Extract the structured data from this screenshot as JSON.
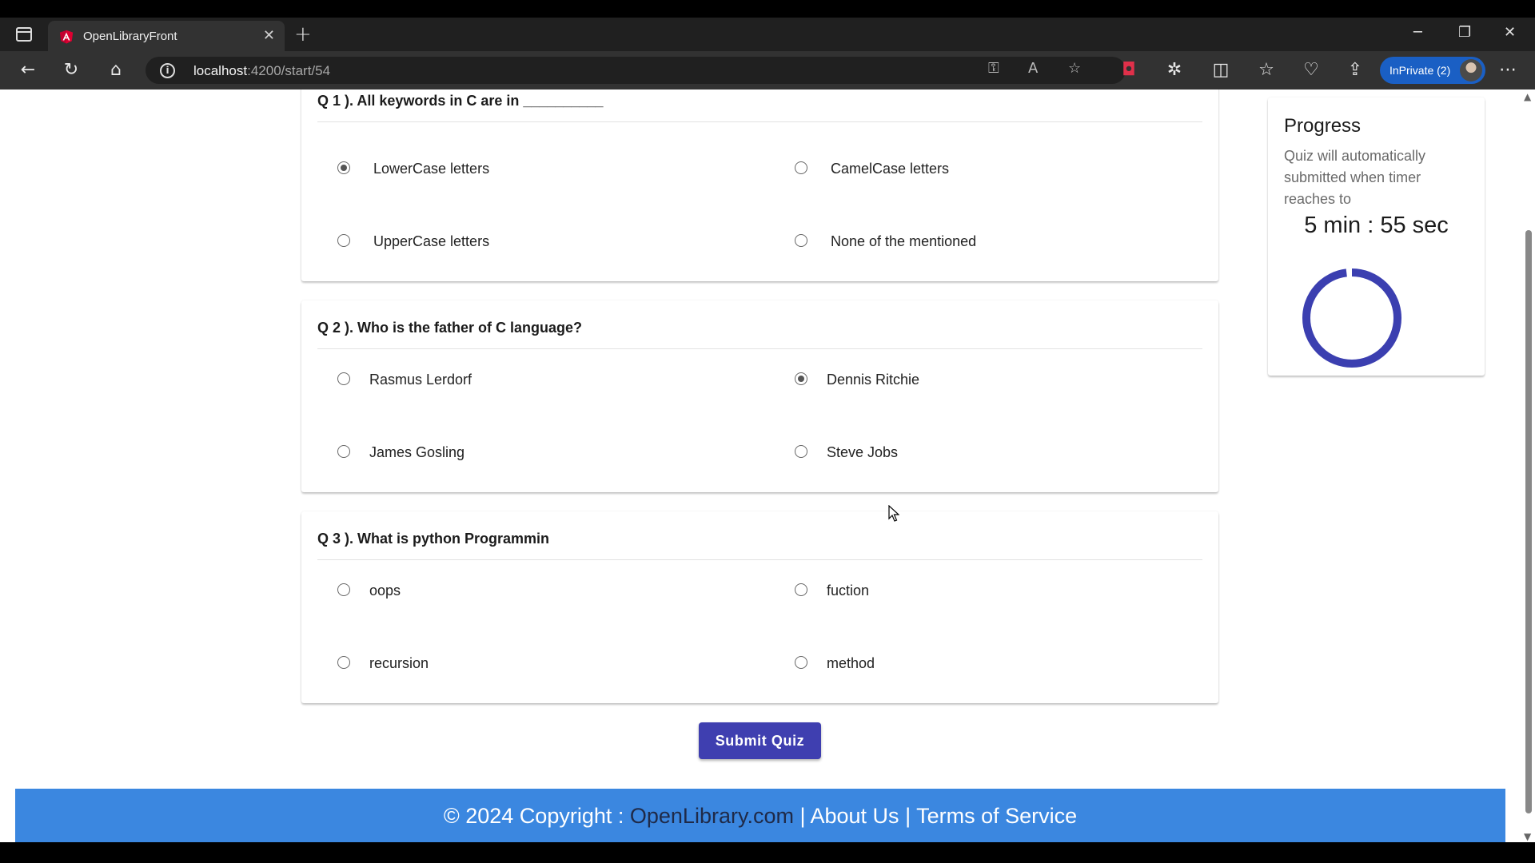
{
  "browser": {
    "tab_title": "OpenLibraryFront",
    "url_host": "localhost",
    "url_path": ":4200/start/54",
    "inprivate_label": "InPrivate (2)"
  },
  "questions": [
    {
      "title": "Q 1 ). All keywords in C are in __________",
      "options": [
        "LowerCase letters",
        "CamelCase letters",
        "UpperCase letters",
        "None of the mentioned"
      ],
      "selected": "LowerCase letters"
    },
    {
      "title": "Q 2 ). Who is the father of C language?",
      "options": [
        "Rasmus Lerdorf",
        "Dennis Ritchie",
        "James Gosling",
        "Steve Jobs"
      ],
      "selected": "Dennis Ritchie"
    },
    {
      "title": "Q 3 ). What is python Programmin",
      "options": [
        "oops",
        "fuction",
        "recursion",
        "method"
      ],
      "selected": null
    }
  ],
  "submit_label": "Submit Quiz",
  "progress": {
    "title": "Progress",
    "description": "Quiz will automatically submitted when timer reaches to",
    "timer": "5 min : 55 sec",
    "ring_fraction": 0.98,
    "ring_color": "#3b3fb0"
  },
  "footer": {
    "prefix": "© 2024 Copyright : ",
    "site_link": "OpenLibrary.com",
    "sep1": " | ",
    "about_link": "About Us",
    "sep2": " | ",
    "terms_link": "Terms of Service"
  },
  "colors": {
    "primary_button": "#3f3fb0",
    "footer_bg": "#3b87e0",
    "browser_accent": "#1a5fc4"
  }
}
